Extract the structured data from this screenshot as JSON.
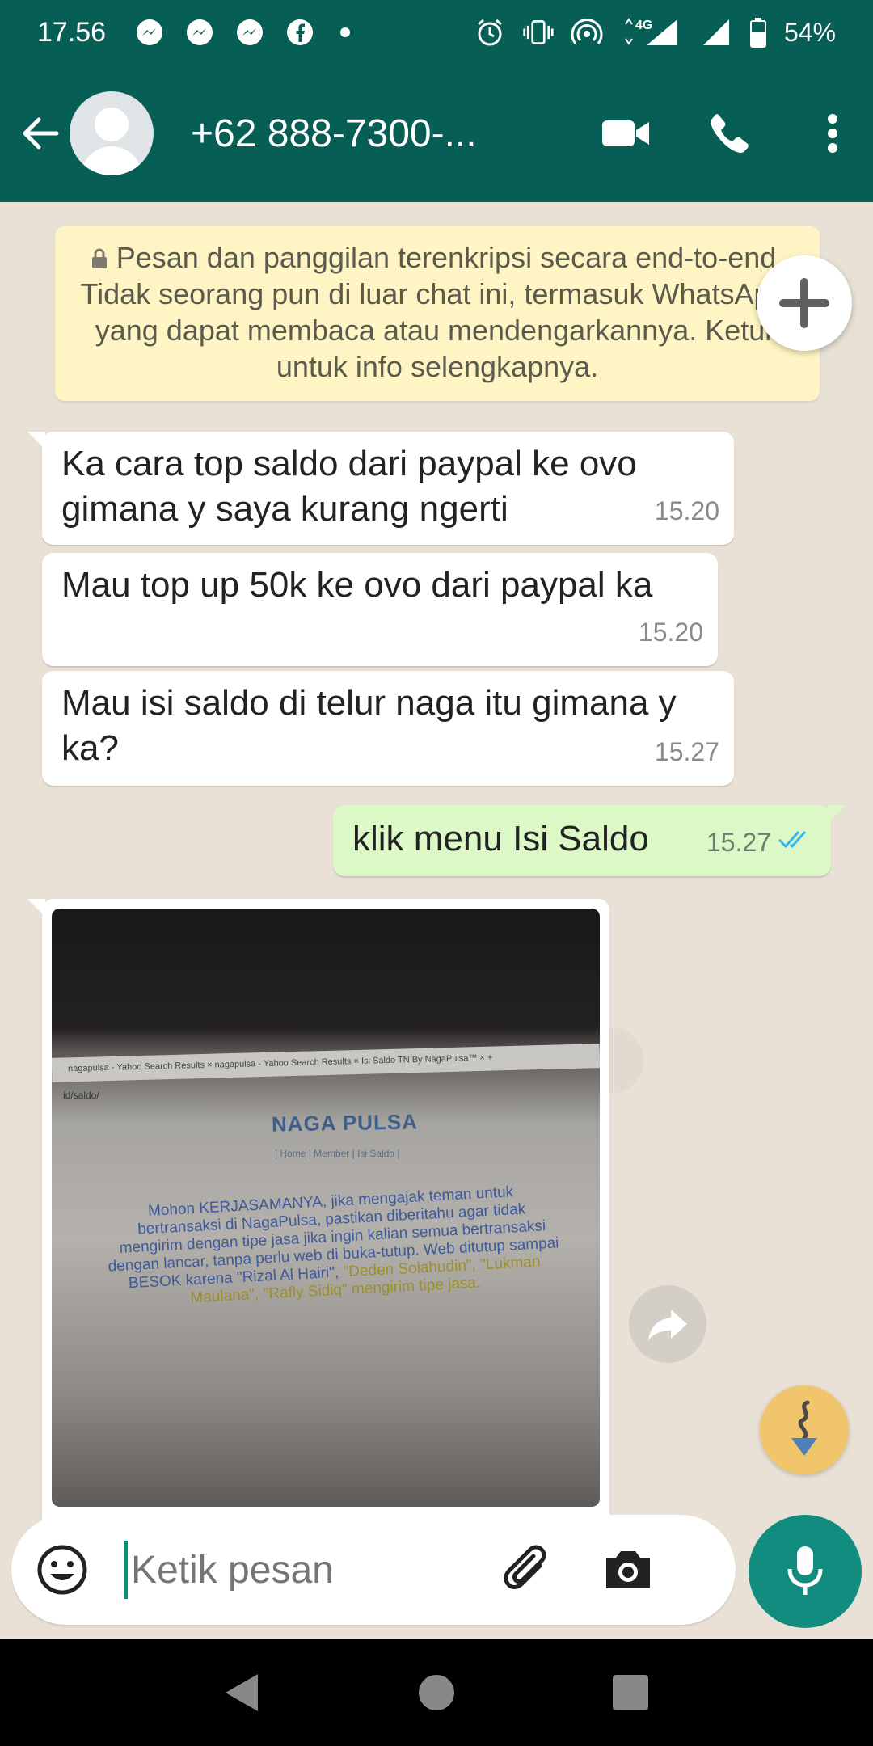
{
  "status_bar": {
    "time": "17.56",
    "network": "4G",
    "battery": "54%"
  },
  "header": {
    "contact": "+62 888-7300-..."
  },
  "encryption_notice": "Pesan dan panggilan terenkripsi secara end-to-end. Tidak seorang pun di luar chat ini, termasuk WhatsApp, yang dapat membaca atau mendengarkannya. Ketuk untuk info selengkapnya.",
  "messages": [
    {
      "text": "Ka cara top saldo dari paypal ke ovo gimana y saya kurang ngerti",
      "time": "15.20",
      "direction": "incoming"
    },
    {
      "text": "Mau top up 50k ke ovo dari paypal ka",
      "time": "15.20",
      "direction": "incoming"
    },
    {
      "text": "Mau isi saldo di telur naga itu gimana y ka?",
      "time": "15.27",
      "direction": "incoming"
    },
    {
      "text": "klik menu Isi Saldo",
      "time": "15.27",
      "direction": "outgoing",
      "status": "read"
    }
  ],
  "image_message": {
    "tabs_text": "nagapulsa - Yahoo Search Results   ×   nagapulsa - Yahoo Search Results   ×   Isi Saldo TN By NagaPulsa™   ×   +",
    "url": "id/saldo/",
    "brand": "NAGA PULSA",
    "nav": "| Home | Member | Isi Saldo |",
    "paragraph": "Mohon KERJASAMANYA, jika mengajak teman untuk bertransaksi di NagaPulsa, pastikan diberitahu agar tidak mengirim dengan tipe jasa jika ingin kalian semua bertransaksi dengan lancar, tanpa perlu web di buka-tutup. Web ditutup sampai BESOK karena \"Rizal Al Hairi\",",
    "paragraph_names": "\"Deden Solahudin\", \"Lukman Maulana\", \"Rafly Sidiq\" mengirim tipe jasa."
  },
  "composer": {
    "placeholder": "Ketik pesan"
  },
  "colors": {
    "header": "#075e54",
    "outgoing_bubble": "#dcf8c6",
    "notice": "#fff5c4",
    "mic_button": "#128c7e",
    "read_ticks": "#34b7f1"
  }
}
